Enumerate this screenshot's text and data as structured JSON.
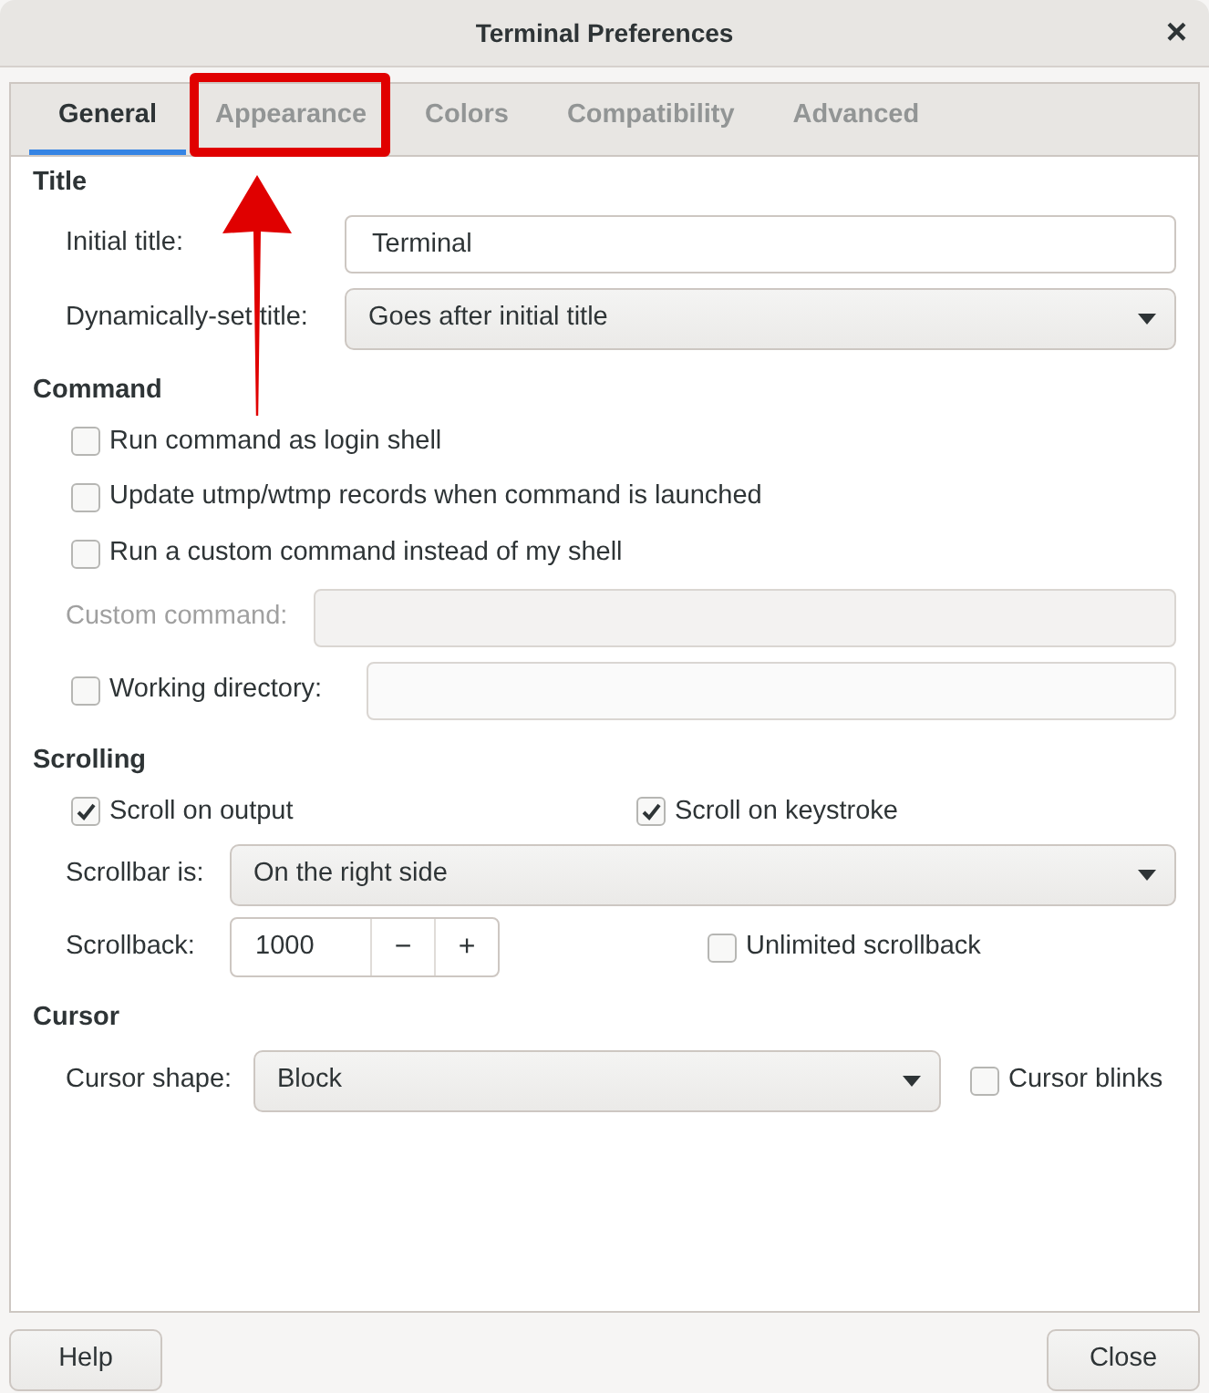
{
  "window": {
    "title": "Terminal Preferences"
  },
  "tabs": [
    {
      "label": "General",
      "selected": true
    },
    {
      "label": "Appearance",
      "selected": false
    },
    {
      "label": "Colors",
      "selected": false
    },
    {
      "label": "Compatibility",
      "selected": false
    },
    {
      "label": "Advanced",
      "selected": false
    }
  ],
  "title_section": {
    "heading": "Title",
    "initial_title": {
      "label": "Initial title:",
      "value": "Terminal"
    },
    "dynamic_title": {
      "label": "Dynamically-set title:",
      "value": "Goes after initial title"
    }
  },
  "command_section": {
    "heading": "Command",
    "options": [
      {
        "label": "Run command as login shell",
        "checked": false
      },
      {
        "label": "Update utmp/wtmp records when command is launched",
        "checked": false
      },
      {
        "label": "Run a custom command instead of my shell",
        "checked": false
      }
    ],
    "custom_command": {
      "label": "Custom command:",
      "disabled": true
    },
    "working_directory": {
      "label": "Working directory:",
      "checked": false
    }
  },
  "scrolling_section": {
    "heading": "Scrolling",
    "scroll_on_output": {
      "label": "Scroll on output",
      "checked": true
    },
    "scroll_on_keystroke": {
      "label": "Scroll on keystroke",
      "checked": true
    },
    "scrollbar": {
      "label": "Scrollbar is:",
      "value": "On the right side"
    },
    "scrollback": {
      "label": "Scrollback:",
      "value": "1000",
      "minus": "−",
      "plus": "+"
    },
    "unlimited": {
      "label": "Unlimited scrollback",
      "checked": false
    }
  },
  "cursor_section": {
    "heading": "Cursor",
    "shape": {
      "label": "Cursor shape:",
      "value": "Block"
    },
    "blinks": {
      "label": "Cursor blinks",
      "checked": false
    }
  },
  "close_glyph": "×",
  "buttons": [
    {
      "label": "Help"
    },
    {
      "label": "Close"
    }
  ]
}
